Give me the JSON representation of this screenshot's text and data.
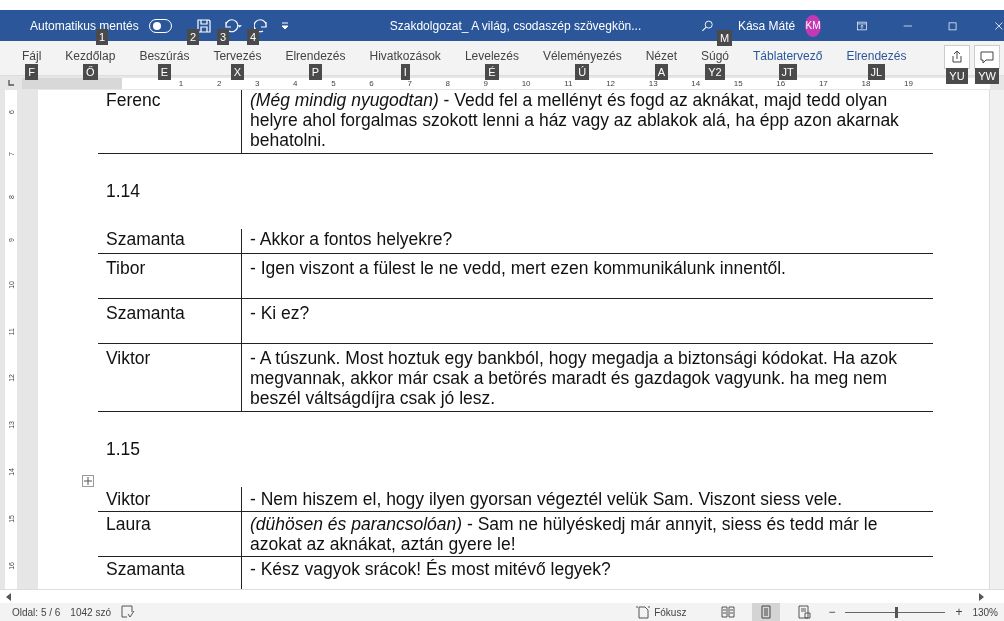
{
  "title_bar": {
    "autosave_label": "Automatikus mentés",
    "autosave_on": false,
    "document_title": "Szakdolgozat_ A világ, csodaszép szövegkön...",
    "user_name": "Kása Máté",
    "user_initials": "KM",
    "keytips": [
      {
        "label": "1"
      },
      {
        "label": "2"
      },
      {
        "label": "3"
      },
      {
        "label": "4"
      },
      {
        "label": "M"
      }
    ]
  },
  "ribbon_tabs": [
    {
      "label": "Fájl",
      "keytip": "F",
      "kind": "normal"
    },
    {
      "label": "Kezdőlap",
      "keytip": "Ő",
      "kind": "normal"
    },
    {
      "label": "Beszúrás",
      "keytip": "E",
      "kind": "normal"
    },
    {
      "label": "Tervezés",
      "keytip": "X",
      "kind": "normal"
    },
    {
      "label": "Elrendezés",
      "keytip": "P",
      "kind": "normal"
    },
    {
      "label": "Hivatkozások",
      "keytip": "I",
      "kind": "normal"
    },
    {
      "label": "Levelezés",
      "keytip": "É",
      "kind": "normal"
    },
    {
      "label": "Véleményezés",
      "keytip": "Ú",
      "kind": "normal"
    },
    {
      "label": "Nézet",
      "keytip": "A",
      "kind": "normal"
    },
    {
      "label": "Súgó",
      "keytip": "Y2",
      "kind": "normal"
    },
    {
      "label": "Táblatervező",
      "keytip": "JT",
      "kind": "contextual"
    },
    {
      "label": "Elrendezés",
      "keytip": "JL",
      "kind": "contextual"
    }
  ],
  "ribbon_buttons": [
    {
      "keytip": "YU"
    },
    {
      "keytip": "YW"
    }
  ],
  "ruler": {
    "numbers": [
      "1",
      "2",
      "3",
      "4",
      "5",
      "6",
      "7",
      "8",
      "9",
      "10",
      "11",
      "12",
      "13",
      "14",
      "15",
      "16",
      "17",
      "18",
      "19"
    ]
  },
  "vertical_ruler": {
    "numbers": [
      "6",
      "7",
      "8",
      "9",
      "10",
      "11",
      "12",
      "13",
      "14",
      "15",
      "16"
    ]
  },
  "document": [
    {
      "kind": "table",
      "rows": [
        {
          "speaker": "Ferenc",
          "line": "*(Még mindig nyugodtan)* - Vedd fel a mellényt és fogd az aknákat, majd tedd olyan helyre ahol forgalmas szokott lenni a ház vagy az ablakok alá, ha épp azon akarnak behatolni."
        }
      ]
    },
    {
      "kind": "heading",
      "text": "1.14"
    },
    {
      "kind": "table",
      "rows": [
        {
          "speaker": "Szamanta",
          "line": "- Akkor a fontos helyekre?"
        },
        {
          "speaker": "Tibor",
          "line": "- Igen viszont a fülest le ne vedd, mert ezen kommunikálunk innentől."
        },
        {
          "speaker": "Szamanta",
          "line": "- Ki ez?"
        },
        {
          "speaker": "Viktor",
          "line": "- A túszunk. Most hoztuk egy bankból, hogy megadja a biztonsági kódokat. Ha azok megvannak, akkor már csak a betörés maradt és gazdagok vagyunk. ha meg nem beszél váltságdíjra csak jó lesz."
        }
      ]
    },
    {
      "kind": "heading",
      "text": "1.15"
    },
    {
      "kind": "table",
      "rows": [
        {
          "speaker": "Viktor",
          "line": "- Nem hiszem el, hogy ilyen gyorsan végeztél velük Sam. Viszont siess vele."
        },
        {
          "speaker": "Laura",
          "line": "*(dühösen és parancsolóan)* - Sam ne hülyéskedj már annyit, siess és tedd már le azokat az aknákat, aztán gyere le!"
        },
        {
          "speaker": "Szamanta",
          "line": "- Kész vagyok srácok! És most mitévő legyek?"
        }
      ]
    }
  ],
  "status_bar": {
    "page": "Oldal: 5 / 6",
    "words": "1042 szó",
    "focus": "Fókusz",
    "views": [
      {
        "kind": "read",
        "selected": false
      },
      {
        "kind": "print",
        "selected": true
      },
      {
        "kind": "web",
        "selected": false
      }
    ],
    "zoom_minus": "−",
    "zoom_plus": "+",
    "zoom": {
      "level": 0.52
    },
    "zoom_percent": "130%"
  }
}
